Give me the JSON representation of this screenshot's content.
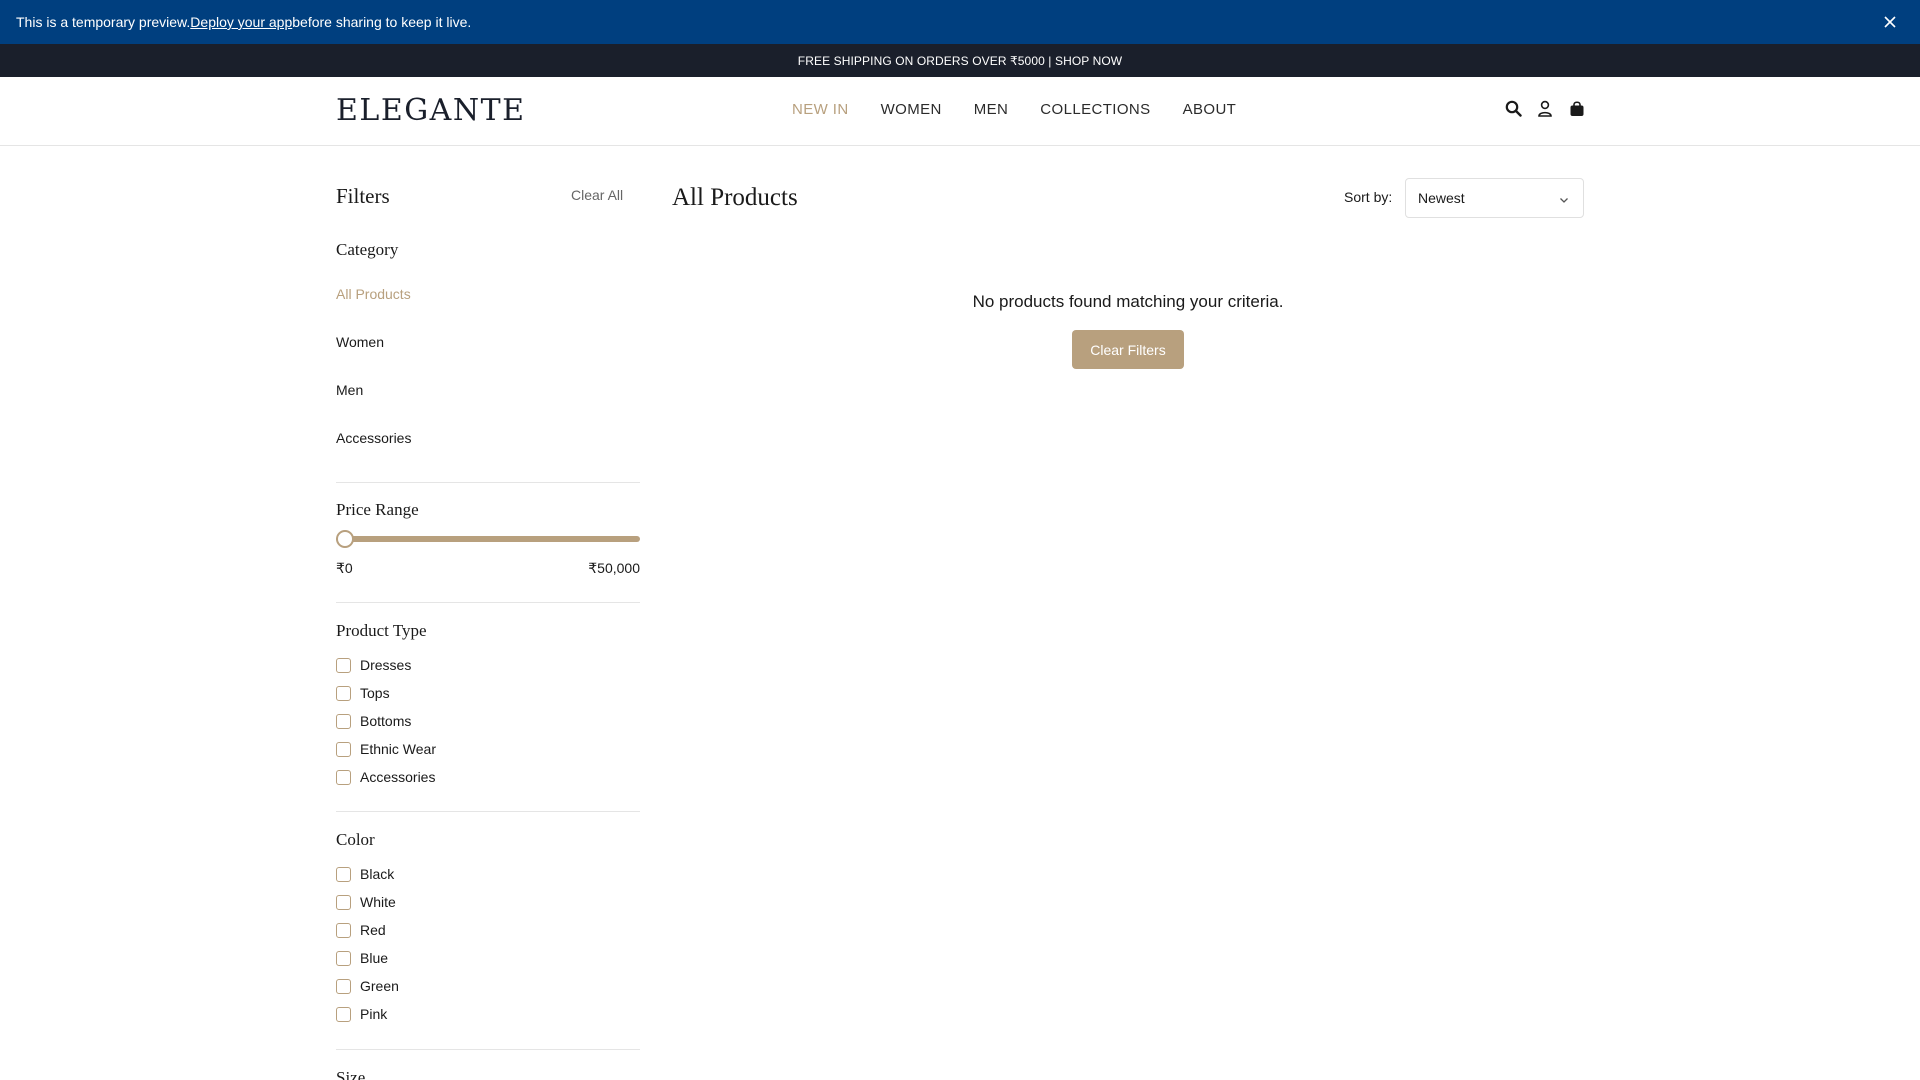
{
  "preview_bar": {
    "text_before": "This is a temporary preview. ",
    "link": "Deploy your app",
    "text_after": " before sharing to keep it live."
  },
  "promo": {
    "text": "FREE SHIPPING ON ORDERS OVER ₹5000 | SHOP NOW"
  },
  "header": {
    "logo": "ELEGANTE",
    "nav": [
      "NEW IN",
      "WOMEN",
      "MEN",
      "COLLECTIONS",
      "ABOUT"
    ],
    "active_nav": "NEW IN",
    "icons": [
      "search-icon",
      "user-icon",
      "bag-icon"
    ]
  },
  "filters": {
    "title": "Filters",
    "clear_all": "Clear All",
    "category": {
      "title": "Category",
      "items": [
        "All Products",
        "Women",
        "Men",
        "Accessories"
      ],
      "active": "All Products"
    },
    "price": {
      "title": "Price Range",
      "min": "₹0",
      "max": "₹50,000",
      "slider_value_fraction": 0
    },
    "product_type": {
      "title": "Product Type",
      "items": [
        "Dresses",
        "Tops",
        "Bottoms",
        "Ethnic Wear",
        "Accessories"
      ]
    },
    "color": {
      "title": "Color",
      "items": [
        "Black",
        "White",
        "Red",
        "Blue",
        "Green",
        "Pink"
      ]
    },
    "size": {
      "title": "Size"
    }
  },
  "main": {
    "title": "All Products",
    "sort_label": "Sort by:",
    "sort_value": "Newest",
    "empty_message": "No products found matching your criteria.",
    "clear_filters": "Clear Filters"
  },
  "colors": {
    "accent": "#b8a07e",
    "preview_bg": "#003f7f",
    "promo_bg": "#1a1f2b"
  }
}
